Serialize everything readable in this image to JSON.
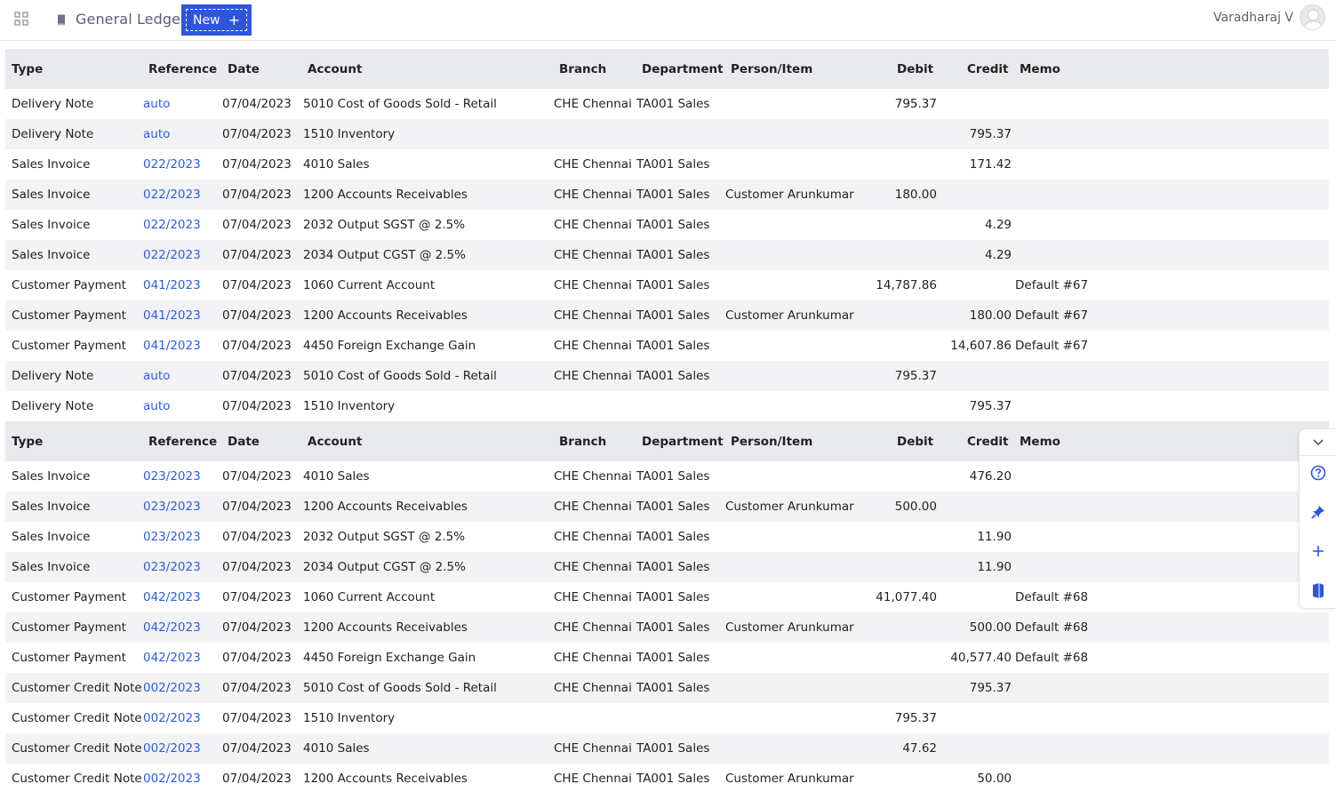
{
  "header": {
    "title": "General Ledger",
    "new_button_label": "New",
    "new_button_icon": "plus-icon",
    "user_name": "Varadharaj V"
  },
  "colors": {
    "accent": "#2d55e0",
    "link": "#2d5ddf",
    "header_row_bg": "#e9eaee",
    "alt_row_bg": "#f3f3f5"
  },
  "columns": [
    "Type",
    "Reference",
    "Date",
    "Account",
    "Branch",
    "Department",
    "Person/Item",
    "Debit",
    "Credit",
    "Memo"
  ],
  "groups": [
    {
      "rows": [
        {
          "type": "Delivery Note",
          "reference": "auto",
          "date": "07/04/2023",
          "account": "5010 Cost of Goods Sold - Retail",
          "branch": "CHE Chennai",
          "department": "TA001 Sales",
          "person": "",
          "debit": "795.37",
          "credit": "",
          "memo": ""
        },
        {
          "type": "Delivery Note",
          "reference": "auto",
          "date": "07/04/2023",
          "account": "1510 Inventory",
          "branch": "",
          "department": "",
          "person": "",
          "debit": "",
          "credit": "795.37",
          "memo": ""
        },
        {
          "type": "Sales Invoice",
          "reference": "022/2023",
          "date": "07/04/2023",
          "account": "4010 Sales",
          "branch": "CHE Chennai",
          "department": "TA001 Sales",
          "person": "",
          "debit": "",
          "credit": "171.42",
          "memo": ""
        },
        {
          "type": "Sales Invoice",
          "reference": "022/2023",
          "date": "07/04/2023",
          "account": "1200 Accounts Receivables",
          "branch": "CHE Chennai",
          "department": "TA001 Sales",
          "person": "Customer Arunkumar",
          "debit": "180.00",
          "credit": "",
          "memo": ""
        },
        {
          "type": "Sales Invoice",
          "reference": "022/2023",
          "date": "07/04/2023",
          "account": "2032 Output SGST @ 2.5%",
          "branch": "CHE Chennai",
          "department": "TA001 Sales",
          "person": "",
          "debit": "",
          "credit": "4.29",
          "memo": ""
        },
        {
          "type": "Sales Invoice",
          "reference": "022/2023",
          "date": "07/04/2023",
          "account": "2034 Output CGST @ 2.5%",
          "branch": "CHE Chennai",
          "department": "TA001 Sales",
          "person": "",
          "debit": "",
          "credit": "4.29",
          "memo": ""
        },
        {
          "type": "Customer Payment",
          "reference": "041/2023",
          "date": "07/04/2023",
          "account": "1060 Current Account",
          "branch": "CHE Chennai",
          "department": "TA001 Sales",
          "person": "",
          "debit": "14,787.86",
          "credit": "",
          "memo": "Default #67"
        },
        {
          "type": "Customer Payment",
          "reference": "041/2023",
          "date": "07/04/2023",
          "account": "1200 Accounts Receivables",
          "branch": "CHE Chennai",
          "department": "TA001 Sales",
          "person": "Customer Arunkumar",
          "debit": "",
          "credit": "180.00",
          "memo": "Default #67"
        },
        {
          "type": "Customer Payment",
          "reference": "041/2023",
          "date": "07/04/2023",
          "account": "4450 Foreign Exchange Gain",
          "branch": "CHE Chennai",
          "department": "TA001 Sales",
          "person": "",
          "debit": "",
          "credit": "14,607.86",
          "memo": "Default #67"
        },
        {
          "type": "Delivery Note",
          "reference": "auto",
          "date": "07/04/2023",
          "account": "5010 Cost of Goods Sold - Retail",
          "branch": "CHE Chennai",
          "department": "TA001 Sales",
          "person": "",
          "debit": "795.37",
          "credit": "",
          "memo": ""
        },
        {
          "type": "Delivery Note",
          "reference": "auto",
          "date": "07/04/2023",
          "account": "1510 Inventory",
          "branch": "",
          "department": "",
          "person": "",
          "debit": "",
          "credit": "795.37",
          "memo": ""
        }
      ]
    },
    {
      "rows": [
        {
          "type": "Sales Invoice",
          "reference": "023/2023",
          "date": "07/04/2023",
          "account": "4010 Sales",
          "branch": "CHE Chennai",
          "department": "TA001 Sales",
          "person": "",
          "debit": "",
          "credit": "476.20",
          "memo": ""
        },
        {
          "type": "Sales Invoice",
          "reference": "023/2023",
          "date": "07/04/2023",
          "account": "1200 Accounts Receivables",
          "branch": "CHE Chennai",
          "department": "TA001 Sales",
          "person": "Customer Arunkumar",
          "debit": "500.00",
          "credit": "",
          "memo": ""
        },
        {
          "type": "Sales Invoice",
          "reference": "023/2023",
          "date": "07/04/2023",
          "account": "2032 Output SGST @ 2.5%",
          "branch": "CHE Chennai",
          "department": "TA001 Sales",
          "person": "",
          "debit": "",
          "credit": "11.90",
          "memo": ""
        },
        {
          "type": "Sales Invoice",
          "reference": "023/2023",
          "date": "07/04/2023",
          "account": "2034 Output CGST @ 2.5%",
          "branch": "CHE Chennai",
          "department": "TA001 Sales",
          "person": "",
          "debit": "",
          "credit": "11.90",
          "memo": ""
        },
        {
          "type": "Customer Payment",
          "reference": "042/2023",
          "date": "07/04/2023",
          "account": "1060 Current Account",
          "branch": "CHE Chennai",
          "department": "TA001 Sales",
          "person": "",
          "debit": "41,077.40",
          "credit": "",
          "memo": "Default #68"
        },
        {
          "type": "Customer Payment",
          "reference": "042/2023",
          "date": "07/04/2023",
          "account": "1200 Accounts Receivables",
          "branch": "CHE Chennai",
          "department": "TA001 Sales",
          "person": "Customer Arunkumar",
          "debit": "",
          "credit": "500.00",
          "memo": "Default #68"
        },
        {
          "type": "Customer Payment",
          "reference": "042/2023",
          "date": "07/04/2023",
          "account": "4450 Foreign Exchange Gain",
          "branch": "CHE Chennai",
          "department": "TA001 Sales",
          "person": "",
          "debit": "",
          "credit": "40,577.40",
          "memo": "Default #68"
        },
        {
          "type": "Customer Credit Note",
          "reference": "002/2023",
          "date": "07/04/2023",
          "account": "5010 Cost of Goods Sold - Retail",
          "branch": "CHE Chennai",
          "department": "TA001 Sales",
          "person": "",
          "debit": "",
          "credit": "795.37",
          "memo": ""
        },
        {
          "type": "Customer Credit Note",
          "reference": "002/2023",
          "date": "07/04/2023",
          "account": "1510 Inventory",
          "branch": "",
          "department": "",
          "person": "",
          "debit": "795.37",
          "credit": "",
          "memo": ""
        },
        {
          "type": "Customer Credit Note",
          "reference": "002/2023",
          "date": "07/04/2023",
          "account": "4010 Sales",
          "branch": "CHE Chennai",
          "department": "TA001 Sales",
          "person": "",
          "debit": "47.62",
          "credit": "",
          "memo": ""
        },
        {
          "type": "Customer Credit Note",
          "reference": "002/2023",
          "date": "07/04/2023",
          "account": "1200 Accounts Receivables",
          "branch": "CHE Chennai",
          "department": "TA001 Sales",
          "person": "Customer Arunkumar",
          "debit": "",
          "credit": "50.00",
          "memo": ""
        }
      ]
    }
  ],
  "side_tools": [
    {
      "name": "collapse-chevron-icon"
    },
    {
      "name": "help-icon"
    },
    {
      "name": "pin-icon"
    },
    {
      "name": "add-icon"
    },
    {
      "name": "book-icon"
    }
  ]
}
